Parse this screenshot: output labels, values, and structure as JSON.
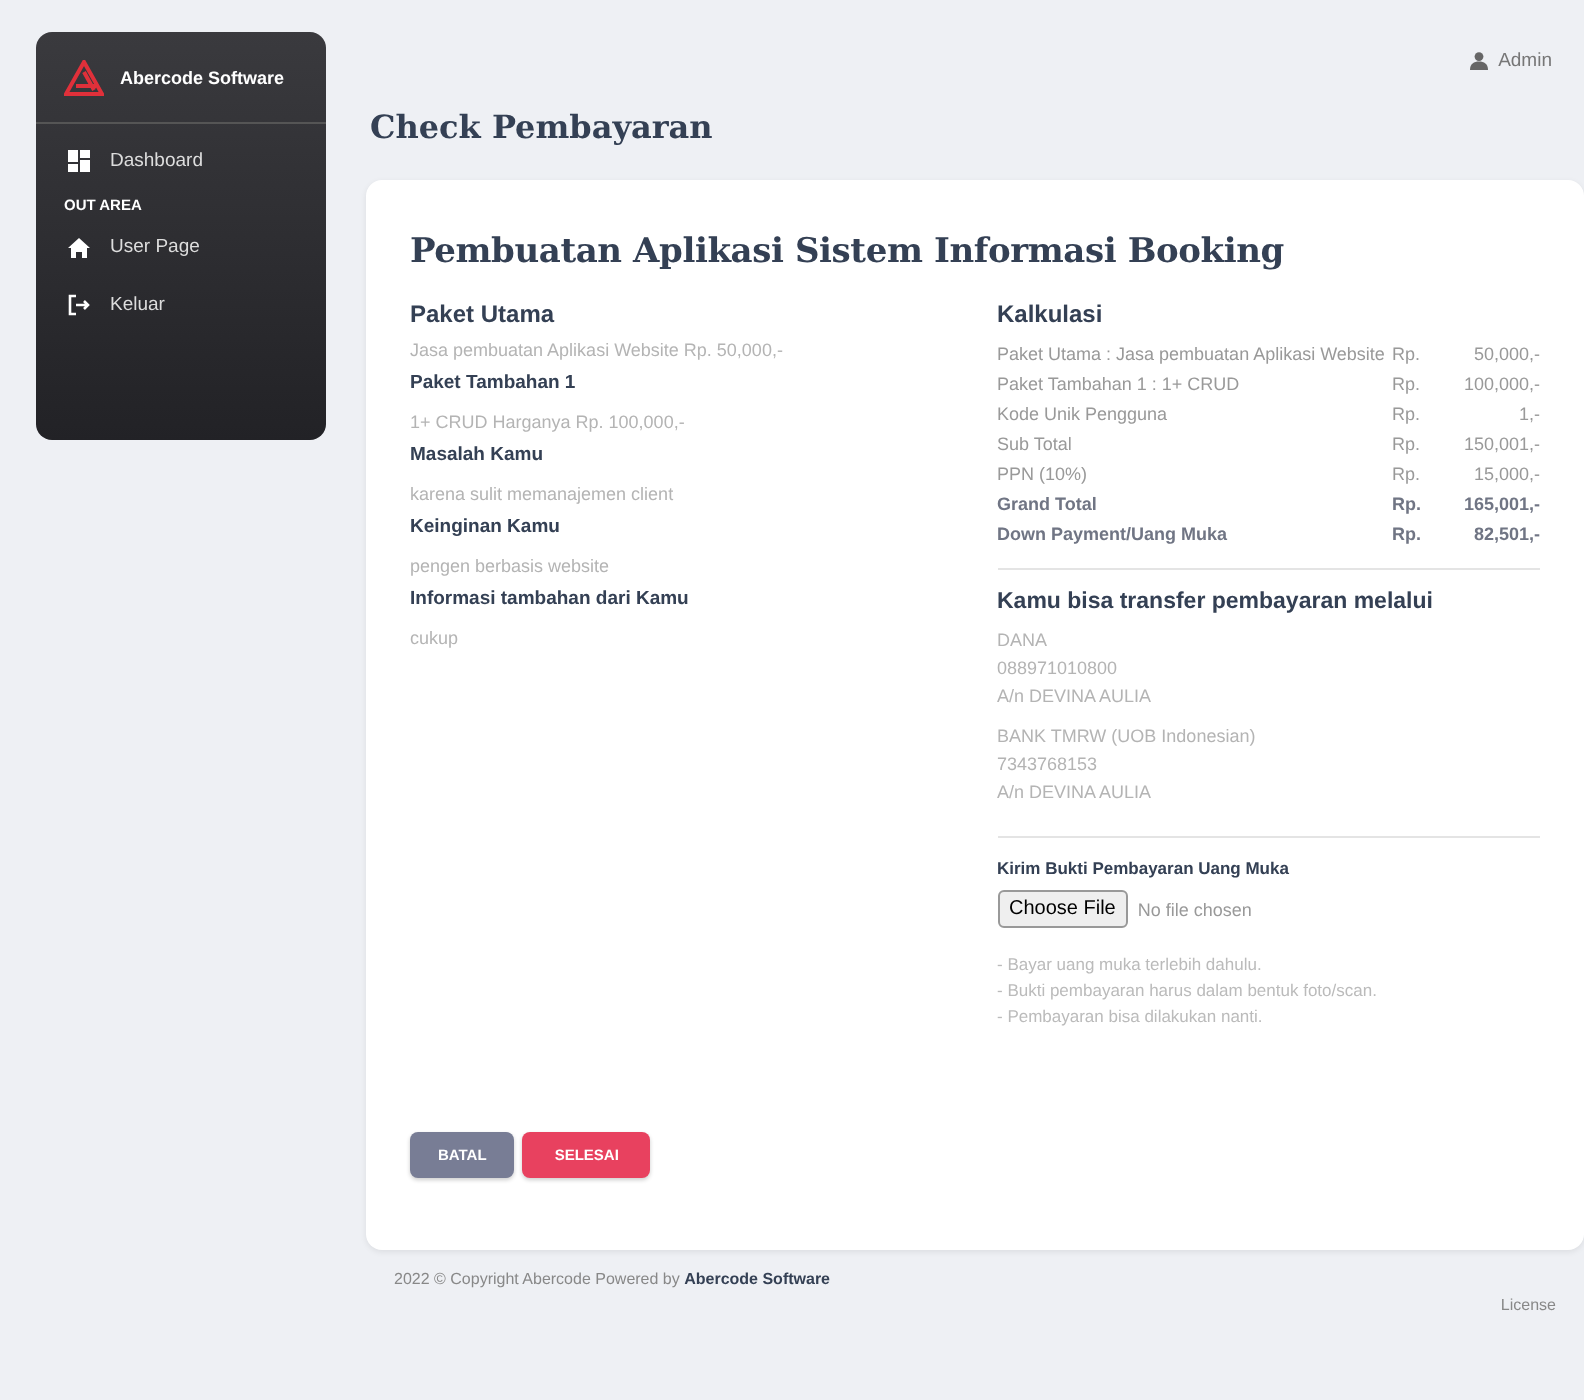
{
  "sidebar": {
    "brand": "Abercode Software",
    "items": [
      {
        "kind": "link",
        "label": "Dashboard"
      },
      {
        "kind": "section",
        "label": "OUT AREA"
      },
      {
        "kind": "link",
        "label": "User Page"
      },
      {
        "kind": "link",
        "label": "Keluar"
      }
    ]
  },
  "user": {
    "name": "Admin"
  },
  "page_title": "Check Pembayaran",
  "card": {
    "title": "Pembuatan Aplikasi Sistem Informasi Booking",
    "details": [
      {
        "kind": "heading",
        "text": "Paket Utama"
      },
      {
        "kind": "value",
        "text": "Jasa pembuatan Aplikasi Website Rp. 50,000,-"
      },
      {
        "kind": "label",
        "text": "Paket Tambahan 1"
      },
      {
        "kind": "value",
        "text": "1+ CRUD Harganya Rp. 100,000,-"
      },
      {
        "kind": "label",
        "text": "Masalah Kamu"
      },
      {
        "kind": "value",
        "text": "karena sulit memanajemen client"
      },
      {
        "kind": "label",
        "text": "Keinginan Kamu"
      },
      {
        "kind": "value",
        "text": "pengen berbasis website"
      },
      {
        "kind": "label",
        "text": "Informasi tambahan dari Kamu"
      },
      {
        "kind": "value",
        "text": "cukup"
      }
    ],
    "calc_title": "Kalkulasi",
    "calc_rows": [
      {
        "kind": "item",
        "label": "Paket Utama : Jasa pembuatan Aplikasi Website",
        "currency": "Rp.",
        "amount": "50,000,-"
      },
      {
        "kind": "item",
        "label": "Paket Tambahan 1 : 1+ CRUD",
        "currency": "Rp.",
        "amount": "100,000,-"
      },
      {
        "kind": "item",
        "label": "Kode Unik Pengguna",
        "currency": "Rp.",
        "amount": "1,-"
      },
      {
        "kind": "item",
        "label": "Sub Total",
        "currency": "Rp.",
        "amount": "150,001,-"
      },
      {
        "kind": "item",
        "label": "PPN (10%)",
        "currency": "Rp.",
        "amount": "15,000,-"
      },
      {
        "kind": "total",
        "label": "Grand Total",
        "currency": "Rp.",
        "amount": "165,001,-"
      },
      {
        "kind": "total",
        "label": "Down Payment/Uang Muka",
        "currency": "Rp.",
        "amount": "82,501,-"
      }
    ],
    "transfer_title": "Kamu bisa transfer pembayaran melalui",
    "accounts": [
      {
        "lines": [
          "DANA",
          "088971010800",
          "A/n DEVINA AULIA"
        ]
      },
      {
        "lines": [
          "BANK TMRW (UOB Indonesian)",
          "7343768153",
          "A/n DEVINA AULIA"
        ]
      }
    ],
    "upload": {
      "label": "Kirim Bukti Pembayaran Uang Muka",
      "button": "Choose File",
      "status": "No file chosen"
    },
    "notes": [
      "- Bayar uang muka terlebih dahulu.",
      "- Bukti pembayaran harus dalam bentuk foto/scan.",
      "- Pembayaran bisa dilakukan nanti."
    ],
    "buttons": [
      {
        "kind": "cancel",
        "label": "BATAL"
      },
      {
        "kind": "submit",
        "label": "SELESAI"
      }
    ]
  },
  "footer": {
    "copyright": "2022 © Copyright Abercode Powered by **Abercode Software**",
    "license": "License"
  }
}
